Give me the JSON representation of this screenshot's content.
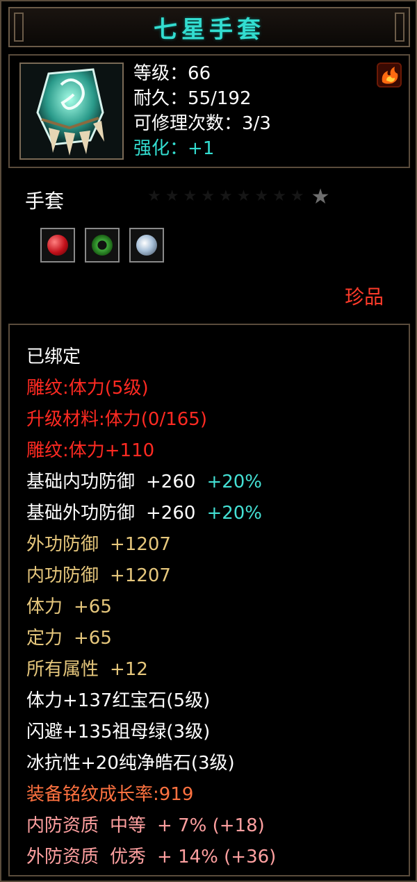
{
  "title": "七星手套",
  "stats": {
    "level_label": "等级",
    "level_value": "66",
    "durability_label": "耐久",
    "durability_value": "55/192",
    "repair_label": "可修理次数",
    "repair_value": "3/3",
    "enhance_label": "强化",
    "enhance_value": "+1"
  },
  "item_type": "手套",
  "star_rating": {
    "filled": 1,
    "max": 10
  },
  "gems": [
    {
      "color": "red",
      "name": "red-gem-icon"
    },
    {
      "color": "green",
      "name": "green-gem-icon"
    },
    {
      "color": "white",
      "name": "white-gem-icon"
    }
  ],
  "quality": "珍品",
  "properties": {
    "bound": "已绑定",
    "engrave1": "雕纹:体力(5级)",
    "upgrade_mat": "升级材料:体力(0/165)",
    "engrave2": "雕纹:体力+110",
    "base_inner_def": {
      "label": "基础内功防御",
      "value": "+260",
      "bonus": "+20%"
    },
    "base_outer_def": {
      "label": "基础外功防御",
      "value": "+260",
      "bonus": "+20%"
    },
    "outer_def": {
      "label": "外功防御",
      "value": "+1207"
    },
    "inner_def": {
      "label": "内功防御",
      "value": "+1207"
    },
    "stamina": {
      "label": "体力",
      "value": "+65"
    },
    "focus": {
      "label": "定力",
      "value": "+65"
    },
    "all_attr": {
      "label": "所有属性",
      "value": "+12"
    },
    "gem1": "体力+137红宝石(5级)",
    "gem2": "闪避+135祖母绿(3级)",
    "gem3": "冰抗性+20纯净皓石(3级)",
    "growth": "装备铭纹成长率:919",
    "inner_quality": {
      "label": "内防资质",
      "grade": "中等",
      "value": "+ 7% (+18)"
    },
    "outer_quality": {
      "label": "外防资质",
      "grade": "优秀",
      "value": "+ 14% (+36)"
    }
  },
  "colors": {
    "title": "#33ddd0",
    "enhance": "#33ddd0",
    "red_text": "#ff2a22",
    "gold_text": "#e6c77c",
    "orange_text": "#ff7240",
    "pink_text": "#ffa0a0",
    "cyan_bonus": "#44e0d4",
    "quality": "#ff3b2a"
  }
}
